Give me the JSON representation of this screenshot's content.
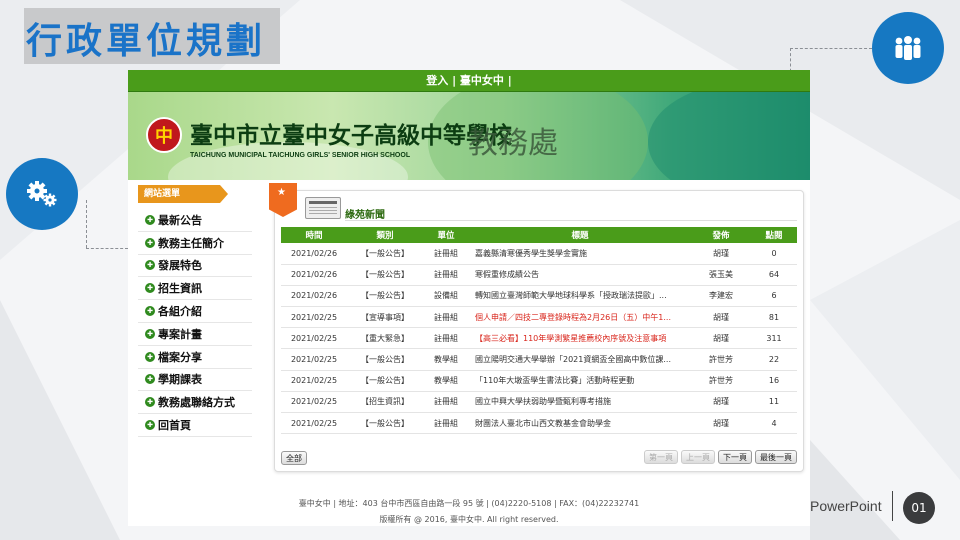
{
  "slide": {
    "title": "行政單位規劃",
    "footer_brand": "PowerPoint",
    "page_number": "01"
  },
  "site": {
    "topbar": "登入 | 臺中女中 |",
    "school_name_zh": "臺中市立臺中女子高級中等學校",
    "school_name_en": "TAICHUNG MUNICIPAL TAICHUNG GIRLS' SENIOR HIGH SCHOOL",
    "department": "教務處",
    "sidebar_header": "網站選單",
    "menu": [
      {
        "label": "最新公告"
      },
      {
        "label": "教務主任簡介"
      },
      {
        "label": "發展特色"
      },
      {
        "label": "招生資訊"
      },
      {
        "label": "各組介紹"
      },
      {
        "label": "專案計畫"
      },
      {
        "label": "檔案分享"
      },
      {
        "label": "學期課表"
      },
      {
        "label": "教務處聯絡方式"
      },
      {
        "label": "回首頁"
      }
    ],
    "news": {
      "title": "綠苑新聞",
      "columns": [
        "時間",
        "類別",
        "單位",
        "標題",
        "發佈",
        "點閱"
      ],
      "rows": [
        {
          "date": "2021/02/26",
          "category": "【一般公告】",
          "unit": "註冊組",
          "title": "嘉義縣清寒優秀學生獎學金實施",
          "author": "胡瑾",
          "views": "0"
        },
        {
          "date": "2021/02/26",
          "category": "【一般公告】",
          "unit": "註冊組",
          "title": "寒假重修成績公告",
          "author": "張玉美",
          "views": "64"
        },
        {
          "date": "2021/02/26",
          "category": "【一般公告】",
          "unit": "設備組",
          "title": "轉知國立臺灣師範大學地球科學系「授政瑞法提歐」...",
          "author": "李建宏",
          "views": "6"
        },
        {
          "date": "2021/02/25",
          "category": "【宣導事項】",
          "unit": "註冊組",
          "title": "個人申請／四技二專登錄時程為2月26日（五）中午1...",
          "author": "胡瑾",
          "views": "81"
        },
        {
          "date": "2021/02/25",
          "category": "【重大緊急】",
          "unit": "註冊組",
          "title": "【高三必看】110年學測繁星推薦校內序號及注意事項",
          "author": "胡瑾",
          "views": "311"
        },
        {
          "date": "2021/02/25",
          "category": "【一般公告】",
          "unit": "教學組",
          "title": "國立陽明交通大學舉辦「2021資網盃全國高中數位課...",
          "author": "許世芳",
          "views": "22"
        },
        {
          "date": "2021/02/25",
          "category": "【一般公告】",
          "unit": "教學組",
          "title": "「110年大墩盃學生書法比賽」活動時程更動",
          "author": "許世芳",
          "views": "16"
        },
        {
          "date": "2021/02/25",
          "category": "【招生資訊】",
          "unit": "註冊組",
          "title": "國立中興大學扶弱助學暨甄利專考措施",
          "author": "胡瑾",
          "views": "11"
        },
        {
          "date": "2021/02/25",
          "category": "【一般公告】",
          "unit": "註冊組",
          "title": "財團法人臺北市山西文教基金會助學金",
          "author": "胡瑾",
          "views": "4"
        }
      ],
      "all_label": "全部",
      "pager": {
        "first": "第一頁",
        "prev": "上一頁",
        "next": "下一頁",
        "last": "最後一頁"
      }
    },
    "footer_line1": "臺中女中 |  地址：403 台中市西區自由路一段 95 號 | (04)2220-5108 | FAX：(04)22232741",
    "footer_line2": "版權所有 @ 2016, 臺中女中. All right reserved."
  },
  "colors": {
    "accent_blue": "#1678c2",
    "site_green": "#4a9c1a",
    "highlight_red": "#d9261c",
    "tab_orange": "#ef6b1f"
  }
}
